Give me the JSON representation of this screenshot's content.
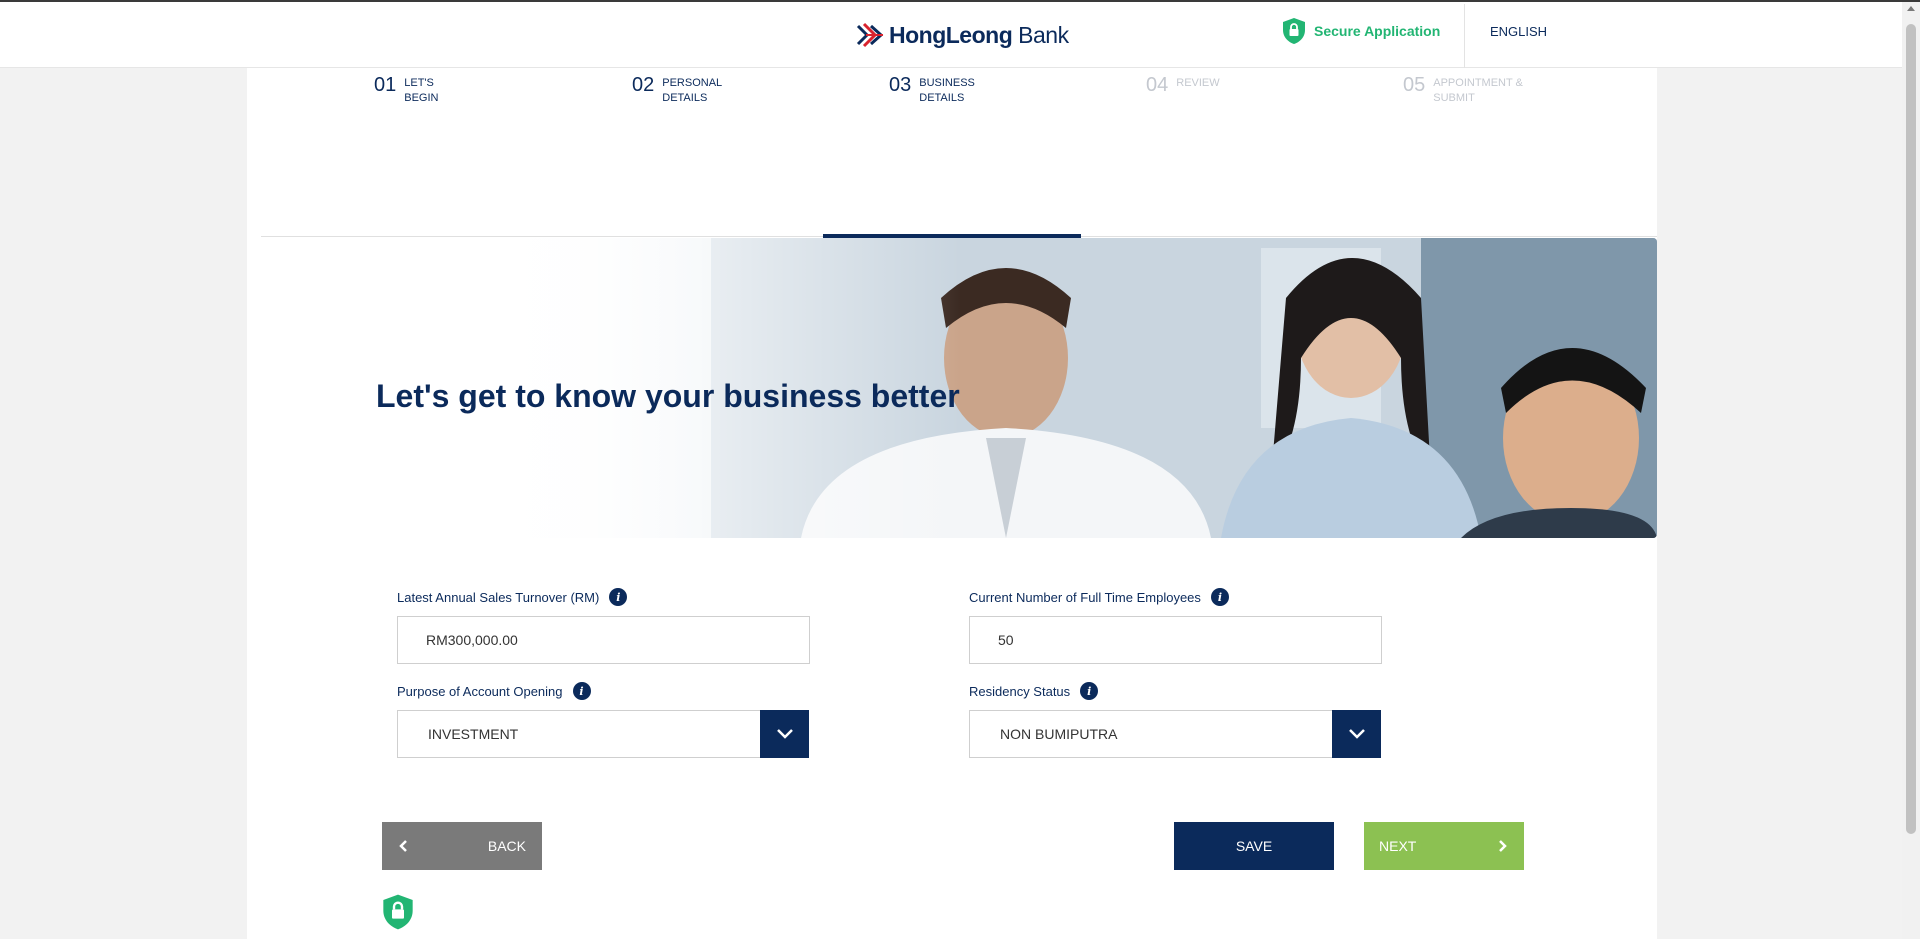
{
  "header": {
    "logo_text_bold": "HongLeong",
    "logo_text_light": " Bank",
    "secure_label": "Secure Application",
    "language": "ENGLISH"
  },
  "steps": [
    {
      "number": "01",
      "label": "Let's\nBegin",
      "state": "completed"
    },
    {
      "number": "02",
      "label": "Personal\nDetails",
      "state": "completed"
    },
    {
      "number": "03",
      "label": "Business\nDetails",
      "state": "active"
    },
    {
      "number": "04",
      "label": "Review",
      "state": "disabled"
    },
    {
      "number": "05",
      "label": "Appointment &\nSubmit",
      "state": "disabled"
    }
  ],
  "hero": {
    "title": "Let's get to know your business better"
  },
  "form": {
    "turnover": {
      "label": "Latest Annual Sales Turnover (RM)",
      "value": "RM300,000.00"
    },
    "employees": {
      "label": "Current Number of Full Time Employees",
      "value": "50"
    },
    "purpose": {
      "label": "Purpose of Account Opening",
      "value": "INVESTMENT"
    },
    "residency": {
      "label": "Residency Status",
      "value": "NON BUMIPUTRA"
    }
  },
  "buttons": {
    "back": "BACK",
    "save": "SAVE",
    "next": "NEXT"
  },
  "colors": {
    "primary": "#0b2a5b",
    "secure_green": "#22b573",
    "next_green": "#8cc152",
    "back_grey": "#7a7a7a"
  }
}
